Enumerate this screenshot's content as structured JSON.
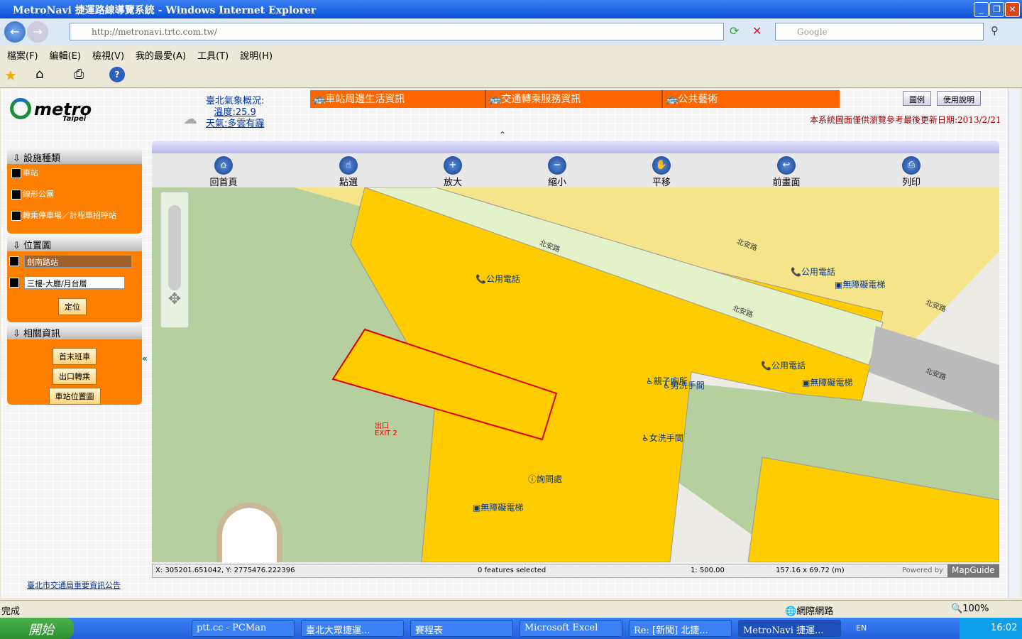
{
  "window": {
    "title": "MetroNavi 捷運路線導覽系統 - Windows Internet Explorer",
    "url": "http://metronavi.trtc.com.tw/",
    "search_placeholder": "Google"
  },
  "menu": [
    "檔案(F)",
    "編輯(E)",
    "檢視(V)",
    "我的最愛(A)",
    "工具(T)",
    "說明(H)"
  ],
  "site": {
    "logo": "metro Taipei",
    "weather": {
      "title": "臺北氣象概況:",
      "temp": "溫度:25.9",
      "cond": "天氣:多雲有霾"
    },
    "topnav": [
      "車站周邊生活資訊",
      "交通轉乘服務資訊",
      "公共藝術"
    ],
    "buttons": {
      "legend": "圖例",
      "help": "使用說明"
    },
    "notice": "本系統圖面僅供瀏覽參考最後更新日期:2013/2/21",
    "panels": {
      "facility": {
        "title": "設施種類",
        "items": [
          "車站",
          "線形公園",
          "轉乘停車場／計程車招呼站"
        ]
      },
      "location": {
        "title": "位置圖",
        "station": "劍南路站",
        "floor": "三樓-大廳/月台層",
        "locate": "定位"
      },
      "related": {
        "title": "相關資訊",
        "items": [
          "首末班車",
          "出口轉乘",
          "車站位置圖"
        ]
      }
    },
    "footer_link": "臺北市交通局重要資訊公告",
    "tools": [
      "回首頁",
      "點選",
      "放大",
      "縮小",
      "平移",
      "前畫面",
      "列印"
    ],
    "map": {
      "roads": [
        "北安路",
        "北安路",
        "北安路",
        "北安路",
        "北安路"
      ],
      "labels": {
        "phone": "公用電話",
        "elevator": "無障礙電梯",
        "family": "親子廁所",
        "mens": "男洗手間",
        "womens": "女洗手間",
        "info": "詢問處",
        "exit": "EXIT 2",
        "exitcn": "出口"
      }
    },
    "status": {
      "coords": "X: 305201.651042, Y: 2775476.222396",
      "selected": "0 features selected",
      "scale": "1: 500.00",
      "size": "157.16 x 69.72 (m)",
      "powered": "Powered by",
      "brand": "MapGuide"
    }
  },
  "ie_status": {
    "text": "完成",
    "zone": "網際網路",
    "zoom": "100%"
  },
  "taskbar": {
    "start": "開始",
    "tasks": [
      "ptt.cc - PCMan",
      "臺北大眾捷運...",
      "賽程表",
      "Microsoft Excel",
      "Re: [新聞] 北捷...",
      "MetroNavi 捷運..."
    ],
    "lang": "EN",
    "time": "16:02"
  }
}
